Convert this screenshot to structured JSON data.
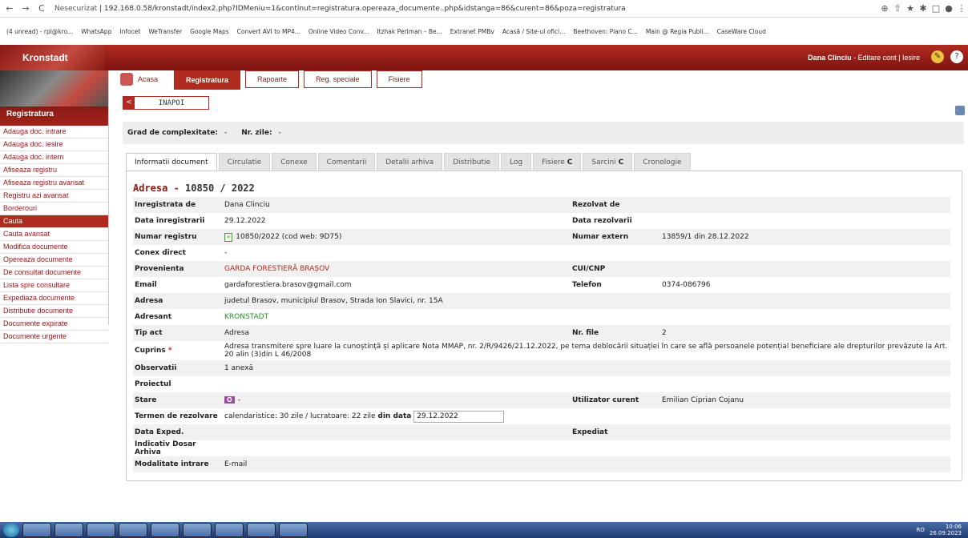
{
  "browser": {
    "url_warning": "Nesecurizat",
    "url": "192.168.0.58/kronstadt/index2.php?IDMeniu=1&continut=registratura.opereaza_documente..php&idstanga=86&curent=86&poza=registratura",
    "bookmarks": [
      "(4 unread) - rpl@kro...",
      "WhatsApp",
      "Infocet",
      "WeTransfer",
      "Google Maps",
      "Convert AVI to MP4...",
      "Online Video Conv...",
      "Itzhak Perlman – Be...",
      "Extranet PMBv",
      "Acasă / Site-ul ofici...",
      "Beethoven: Piano C...",
      "Main @ Regia Publi...",
      "CaseWare Cloud"
    ]
  },
  "app": {
    "brand": "Kronstadt",
    "user": "Dana Clinciu",
    "user_links": "- Editare cont | Iesire"
  },
  "sidebar": {
    "title": "Registratura",
    "items": [
      "Adauga doc. intrare",
      "Adauga doc. iesire",
      "Adauga doc. intern",
      "Afiseaza registru",
      "Afiseaza registru avansat",
      "Registru azi avansat",
      "Borderouri",
      "Cauta",
      "Cauta avansat",
      "Modifica documente",
      "Opereaza documente",
      "De consultat documente",
      "Lista spre consultare",
      "Expediaza documente",
      "Distributie documente",
      "Documente expirate",
      "Documente urgente"
    ],
    "active_index": 7
  },
  "main_tabs": [
    "Acasa",
    "Registratura",
    "Rapoarte",
    "Reg. speciale",
    "Fisiere"
  ],
  "back_label": "INAPOI",
  "grad": {
    "label": "Grad de complexitate:",
    "value": "-",
    "zile_label": "Nr. zile:",
    "zile_value": "-"
  },
  "doc_tabs": [
    "Informatii document",
    "Circulatie",
    "Conexe",
    "Comentarii",
    "Detalii arhiva",
    "Distributie",
    "Log",
    "Fisiere",
    "Sarcini",
    "Cronologie"
  ],
  "doc": {
    "type": "Adresa",
    "sep": " - ",
    "number": "10850 / 2022",
    "rows": [
      {
        "l": "Inregistrata de",
        "v": "Dana Clinciu",
        "l2": "Rezolvat de",
        "v2": ""
      },
      {
        "l": "Data inregistrarii",
        "v": "29.12.2022",
        "l2": "Data rezolvarii",
        "v2": ""
      },
      {
        "l": "Numar registru",
        "v": "10850/2022 (cod web: 9D75)",
        "l2": "Numar extern",
        "v2": "13859/1 din 28.12.2022"
      },
      {
        "l": "Conex direct",
        "v": "-",
        "l2": "",
        "v2": ""
      },
      {
        "l": "Provenienta",
        "v": "GARDA FORESTIERĂ BRAȘOV",
        "l2": "CUI/CNP",
        "v2": ""
      },
      {
        "l": "Email",
        "v": "gardaforestiera.brasov@gmail.com",
        "l2": "Telefon",
        "v2": "0374-086796"
      },
      {
        "l": "Adresa",
        "v": "judetul Brasov, municipiul Brasov, Strada Ion Slavici, nr. 15A",
        "l2": "",
        "v2": ""
      },
      {
        "l": "Adresant",
        "v": "KRONSTADT",
        "l2": "",
        "v2": ""
      },
      {
        "l": "Tip act",
        "v": "Adresa",
        "l2": "Nr. file",
        "v2": "2"
      },
      {
        "l": "Cuprins",
        "v": "Adresa transmitere spre luare la cunoștință și aplicare Nota MMAP, nr. 2/R/9426/21.12.2022, pe tema deblocării situației în care se află persoanele potențial beneficiare ale drepturilor prevăzute la Art. 20 alin (3)din L 46/2008",
        "l2": "",
        "v2": ""
      },
      {
        "l": "Observatii",
        "v": "1 anexă",
        "l2": "",
        "v2": ""
      },
      {
        "l": "Proiectul",
        "v": "",
        "l2": "",
        "v2": ""
      },
      {
        "l": "Stare",
        "v": "-",
        "badge": "O",
        "l2": "Utilizator curent",
        "v2": "Emilian Ciprian Cojanu"
      },
      {
        "l": "Termen de rezolvare",
        "v": "calendaristice: 30 zile / lucratoare: 22 zile",
        "din": "din data",
        "date": "29.12.2022",
        "l2": "",
        "v2": ""
      },
      {
        "l": "Data Exped.",
        "v": "",
        "l2": "Expediat",
        "v2": ""
      },
      {
        "l": "Indicativ Dosar Arhiva",
        "v": "",
        "l2": "",
        "v2": ""
      },
      {
        "l": "Modalitate intrare",
        "v": "E-mail",
        "l2": "",
        "v2": ""
      }
    ]
  },
  "taskbar": {
    "lang": "RO",
    "time": "10:06",
    "date": "26.09.2023"
  }
}
